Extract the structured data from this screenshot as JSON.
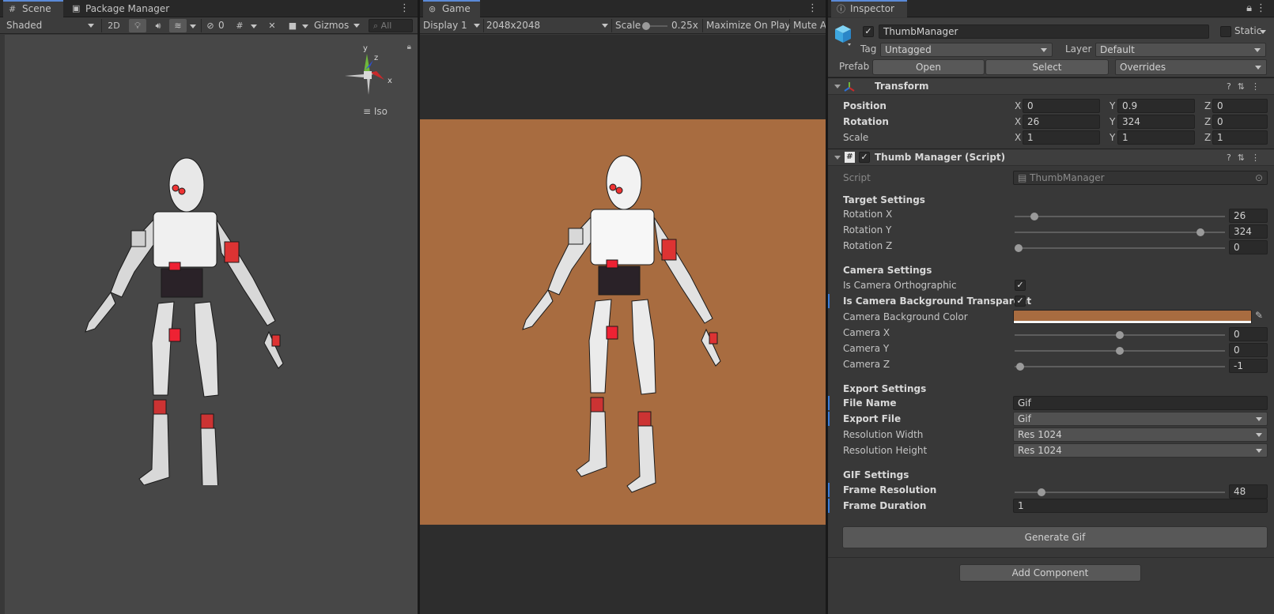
{
  "scene_tabs": {
    "scene": "Scene",
    "package_manager": "Package Manager"
  },
  "scene_toolbar": {
    "shading": "Shaded",
    "mode_2d": "2D",
    "hidden_count": "0",
    "gizmos": "Gizmos",
    "search_placeholder": "All"
  },
  "scene_view": {
    "projection": "Iso",
    "axes": {
      "x": "x",
      "y": "y",
      "z": "z"
    }
  },
  "game_tabs": {
    "game": "Game"
  },
  "game_toolbar": {
    "display": "Display 1",
    "resolution": "2048x2048",
    "scale_label": "Scale",
    "scale_value": "0.25x",
    "maximize": "Maximize On Play",
    "mute": "Mute A"
  },
  "colors": {
    "camera_background": "#a86c40",
    "accent": "#5a8ad8",
    "modified": "#3c7cd8"
  },
  "inspector": {
    "tab": "Inspector",
    "object_name": "ThumbManager",
    "static_label": "Static",
    "tag_label": "Tag",
    "tag_value": "Untagged",
    "layer_label": "Layer",
    "layer_value": "Default",
    "prefab_label": "Prefab",
    "prefab_open": "Open",
    "prefab_select": "Select",
    "prefab_overrides": "Overrides",
    "transform": {
      "title": "Transform",
      "position_label": "Position",
      "rotation_label": "Rotation",
      "scale_label": "Scale",
      "axis_x": "X",
      "axis_y": "Y",
      "axis_z": "Z",
      "position": {
        "x": "0",
        "y": "0.9",
        "z": "0"
      },
      "rotation": {
        "x": "26",
        "y": "324",
        "z": "0"
      },
      "scale": {
        "x": "1",
        "y": "1",
        "z": "1"
      }
    },
    "script_component": {
      "title": "Thumb Manager (Script)",
      "script_label": "Script",
      "script_value": "ThumbManager",
      "target_settings": "Target Settings",
      "rotation_x_label": "Rotation X",
      "rotation_x": "26",
      "rotation_y_label": "Rotation Y",
      "rotation_y": "324",
      "rotation_z_label": "Rotation Z",
      "rotation_z": "0",
      "camera_settings": "Camera Settings",
      "ortho_label": "Is Camera Orthographic",
      "transparent_label": "Is Camera Background Transparent",
      "bg_color_label": "Camera Background Color",
      "camera_x_label": "Camera X",
      "camera_x": "0",
      "camera_y_label": "Camera Y",
      "camera_y": "0",
      "camera_z_label": "Camera Z",
      "camera_z": "-1",
      "export_settings": "Export Settings",
      "file_name_label": "File Name",
      "file_name": "Gif",
      "export_file_label": "Export File",
      "export_file": "Gif",
      "res_width_label": "Resolution Width",
      "res_width": "Res 1024",
      "res_height_label": "Resolution Height",
      "res_height": "Res 1024",
      "gif_settings": "GIF Settings",
      "frame_res_label": "Frame Resolution",
      "frame_res": "48",
      "frame_dur_label": "Frame Duration",
      "frame_dur": "1",
      "generate": "Generate Gif"
    },
    "add_component": "Add Component"
  }
}
